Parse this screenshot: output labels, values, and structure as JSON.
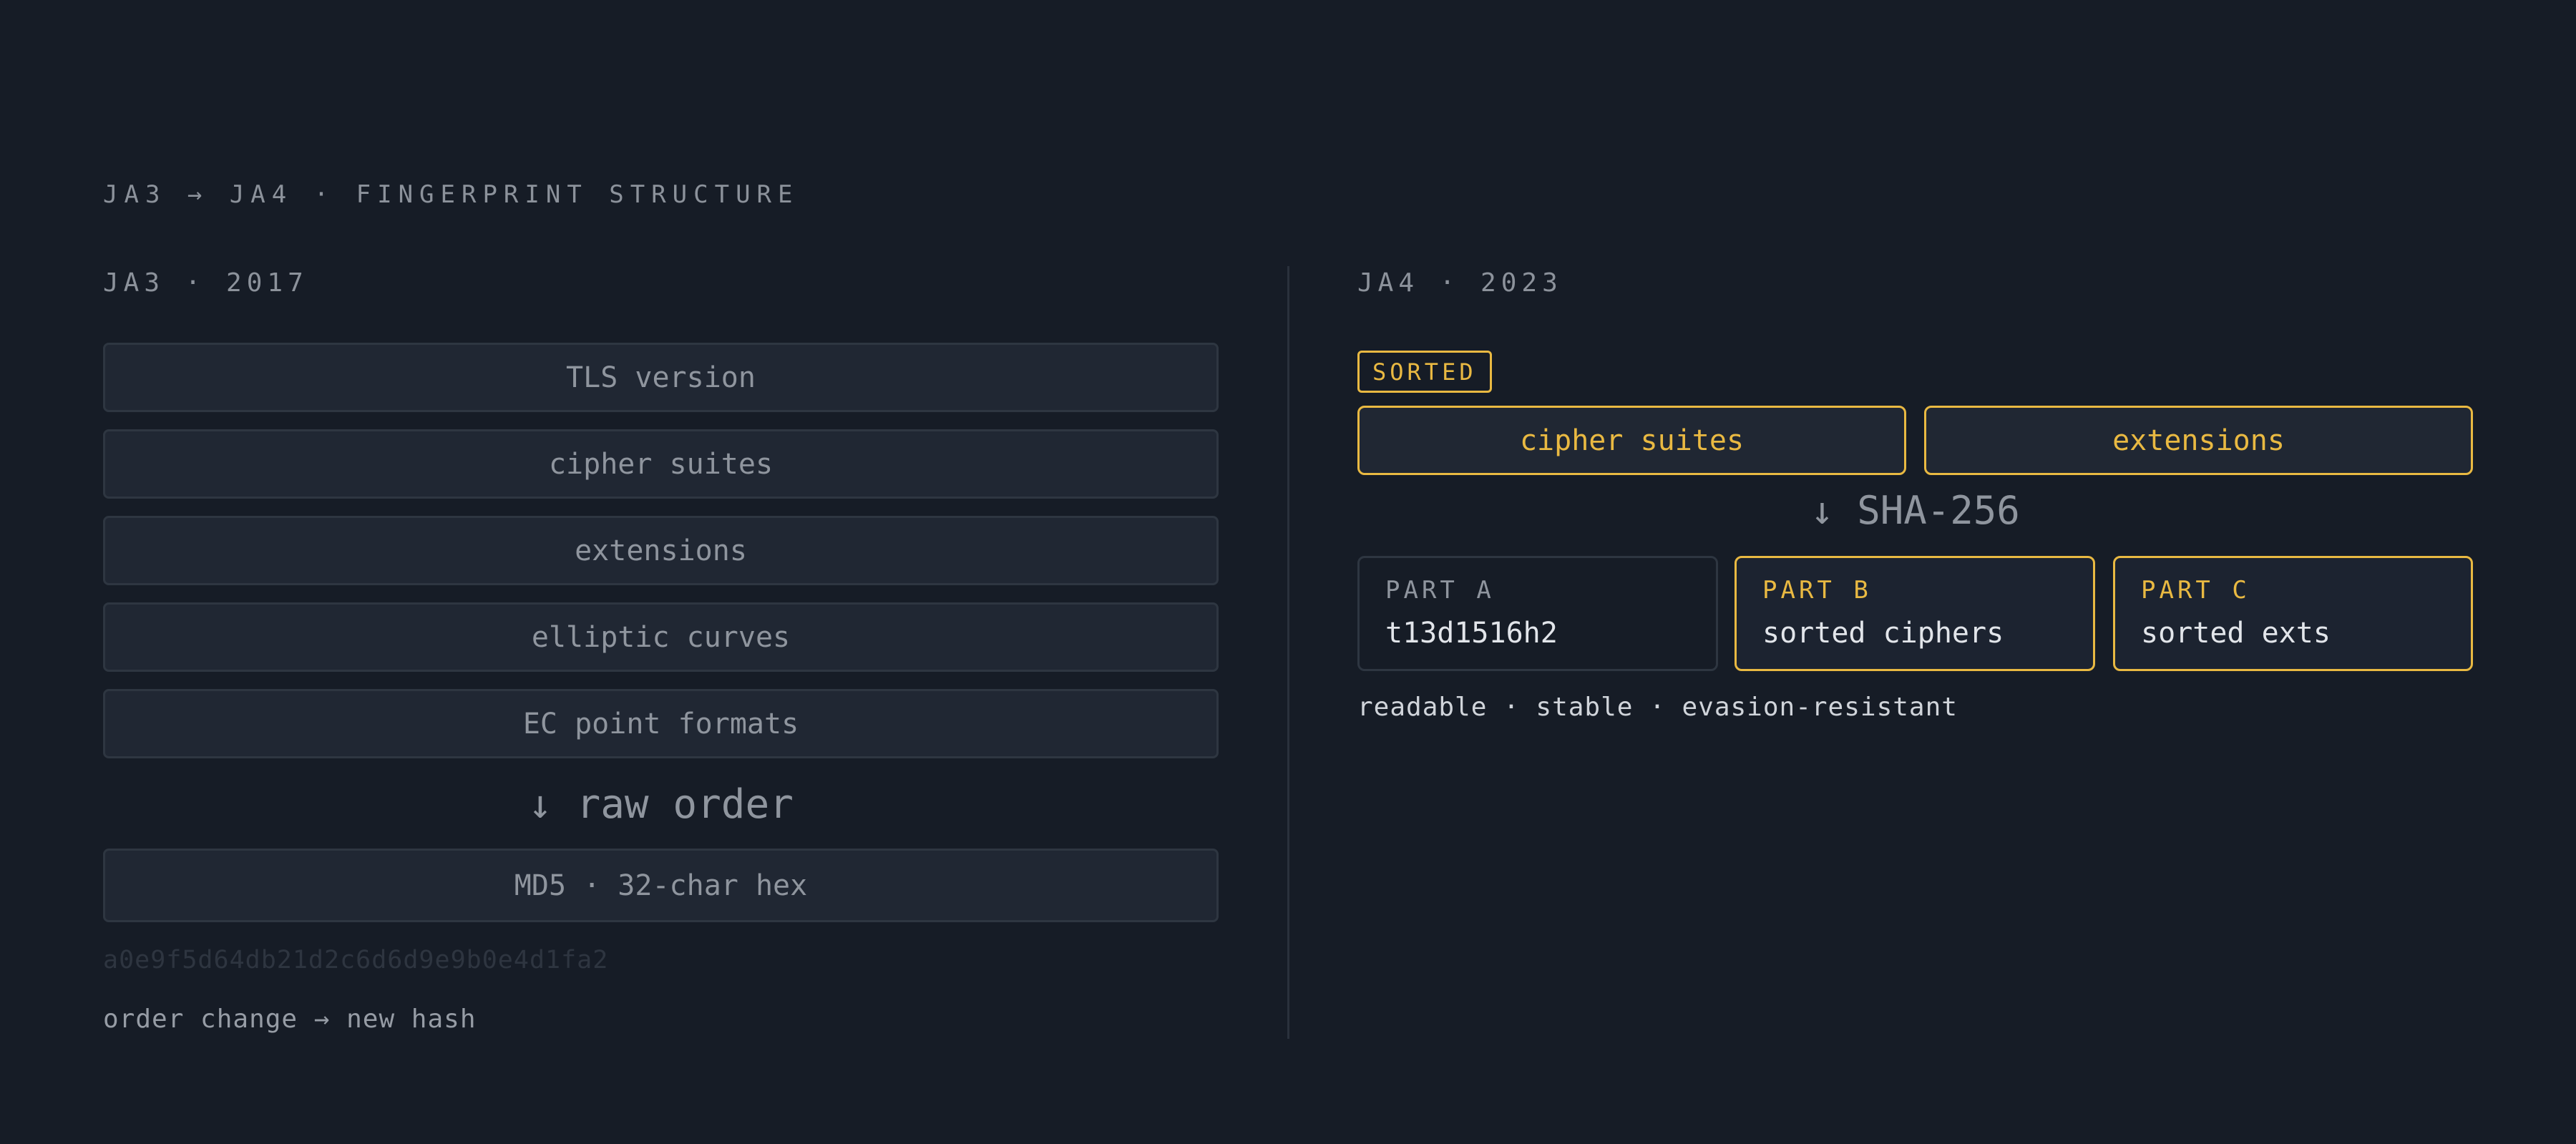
{
  "title": "JA3 → JA4 · FINGERPRINT STRUCTURE",
  "colors": {
    "background": "#161c26",
    "box_fill": "#202733",
    "box_border": "#2e3641",
    "accent": "#e9b942",
    "text_muted": "#8f959e",
    "text_bright": "#e2e5ea"
  },
  "ja3": {
    "heading": "JA3 · 2017",
    "fields": [
      "TLS version",
      "cipher suites",
      "extensions",
      "elliptic curves",
      "EC point formats"
    ],
    "arrow_label": "↓ raw order",
    "hash_box": "MD5 · 32-char hex",
    "hash_example": "a0e9f5d64db21d2c6d6d9e9b0e4d1fa2",
    "note": "order change → new hash"
  },
  "ja4": {
    "heading": "JA4 · 2023",
    "sorted_badge": "SORTED",
    "sorted_fields": [
      "cipher suites",
      "extensions"
    ],
    "arrow_label": "↓ SHA-256",
    "parts": [
      {
        "label": "PART A",
        "value": "t13d1516h2"
      },
      {
        "label": "PART B",
        "value": "sorted ciphers"
      },
      {
        "label": "PART C",
        "value": "sorted exts"
      }
    ],
    "note": "readable · stable · evasion-resistant"
  }
}
